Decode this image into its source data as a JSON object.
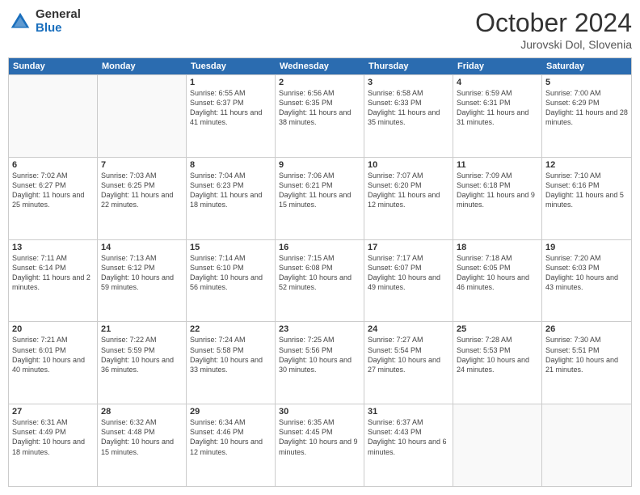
{
  "logo": {
    "general": "General",
    "blue": "Blue"
  },
  "header": {
    "month": "October 2024",
    "location": "Jurovski Dol, Slovenia"
  },
  "weekdays": [
    "Sunday",
    "Monday",
    "Tuesday",
    "Wednesday",
    "Thursday",
    "Friday",
    "Saturday"
  ],
  "weeks": [
    [
      {
        "day": "",
        "sunrise": "",
        "sunset": "",
        "daylight": ""
      },
      {
        "day": "",
        "sunrise": "",
        "sunset": "",
        "daylight": ""
      },
      {
        "day": "1",
        "sunrise": "Sunrise: 6:55 AM",
        "sunset": "Sunset: 6:37 PM",
        "daylight": "Daylight: 11 hours and 41 minutes."
      },
      {
        "day": "2",
        "sunrise": "Sunrise: 6:56 AM",
        "sunset": "Sunset: 6:35 PM",
        "daylight": "Daylight: 11 hours and 38 minutes."
      },
      {
        "day": "3",
        "sunrise": "Sunrise: 6:58 AM",
        "sunset": "Sunset: 6:33 PM",
        "daylight": "Daylight: 11 hours and 35 minutes."
      },
      {
        "day": "4",
        "sunrise": "Sunrise: 6:59 AM",
        "sunset": "Sunset: 6:31 PM",
        "daylight": "Daylight: 11 hours and 31 minutes."
      },
      {
        "day": "5",
        "sunrise": "Sunrise: 7:00 AM",
        "sunset": "Sunset: 6:29 PM",
        "daylight": "Daylight: 11 hours and 28 minutes."
      }
    ],
    [
      {
        "day": "6",
        "sunrise": "Sunrise: 7:02 AM",
        "sunset": "Sunset: 6:27 PM",
        "daylight": "Daylight: 11 hours and 25 minutes."
      },
      {
        "day": "7",
        "sunrise": "Sunrise: 7:03 AM",
        "sunset": "Sunset: 6:25 PM",
        "daylight": "Daylight: 11 hours and 22 minutes."
      },
      {
        "day": "8",
        "sunrise": "Sunrise: 7:04 AM",
        "sunset": "Sunset: 6:23 PM",
        "daylight": "Daylight: 11 hours and 18 minutes."
      },
      {
        "day": "9",
        "sunrise": "Sunrise: 7:06 AM",
        "sunset": "Sunset: 6:21 PM",
        "daylight": "Daylight: 11 hours and 15 minutes."
      },
      {
        "day": "10",
        "sunrise": "Sunrise: 7:07 AM",
        "sunset": "Sunset: 6:20 PM",
        "daylight": "Daylight: 11 hours and 12 minutes."
      },
      {
        "day": "11",
        "sunrise": "Sunrise: 7:09 AM",
        "sunset": "Sunset: 6:18 PM",
        "daylight": "Daylight: 11 hours and 9 minutes."
      },
      {
        "day": "12",
        "sunrise": "Sunrise: 7:10 AM",
        "sunset": "Sunset: 6:16 PM",
        "daylight": "Daylight: 11 hours and 5 minutes."
      }
    ],
    [
      {
        "day": "13",
        "sunrise": "Sunrise: 7:11 AM",
        "sunset": "Sunset: 6:14 PM",
        "daylight": "Daylight: 11 hours and 2 minutes."
      },
      {
        "day": "14",
        "sunrise": "Sunrise: 7:13 AM",
        "sunset": "Sunset: 6:12 PM",
        "daylight": "Daylight: 10 hours and 59 minutes."
      },
      {
        "day": "15",
        "sunrise": "Sunrise: 7:14 AM",
        "sunset": "Sunset: 6:10 PM",
        "daylight": "Daylight: 10 hours and 56 minutes."
      },
      {
        "day": "16",
        "sunrise": "Sunrise: 7:15 AM",
        "sunset": "Sunset: 6:08 PM",
        "daylight": "Daylight: 10 hours and 52 minutes."
      },
      {
        "day": "17",
        "sunrise": "Sunrise: 7:17 AM",
        "sunset": "Sunset: 6:07 PM",
        "daylight": "Daylight: 10 hours and 49 minutes."
      },
      {
        "day": "18",
        "sunrise": "Sunrise: 7:18 AM",
        "sunset": "Sunset: 6:05 PM",
        "daylight": "Daylight: 10 hours and 46 minutes."
      },
      {
        "day": "19",
        "sunrise": "Sunrise: 7:20 AM",
        "sunset": "Sunset: 6:03 PM",
        "daylight": "Daylight: 10 hours and 43 minutes."
      }
    ],
    [
      {
        "day": "20",
        "sunrise": "Sunrise: 7:21 AM",
        "sunset": "Sunset: 6:01 PM",
        "daylight": "Daylight: 10 hours and 40 minutes."
      },
      {
        "day": "21",
        "sunrise": "Sunrise: 7:22 AM",
        "sunset": "Sunset: 5:59 PM",
        "daylight": "Daylight: 10 hours and 36 minutes."
      },
      {
        "day": "22",
        "sunrise": "Sunrise: 7:24 AM",
        "sunset": "Sunset: 5:58 PM",
        "daylight": "Daylight: 10 hours and 33 minutes."
      },
      {
        "day": "23",
        "sunrise": "Sunrise: 7:25 AM",
        "sunset": "Sunset: 5:56 PM",
        "daylight": "Daylight: 10 hours and 30 minutes."
      },
      {
        "day": "24",
        "sunrise": "Sunrise: 7:27 AM",
        "sunset": "Sunset: 5:54 PM",
        "daylight": "Daylight: 10 hours and 27 minutes."
      },
      {
        "day": "25",
        "sunrise": "Sunrise: 7:28 AM",
        "sunset": "Sunset: 5:53 PM",
        "daylight": "Daylight: 10 hours and 24 minutes."
      },
      {
        "day": "26",
        "sunrise": "Sunrise: 7:30 AM",
        "sunset": "Sunset: 5:51 PM",
        "daylight": "Daylight: 10 hours and 21 minutes."
      }
    ],
    [
      {
        "day": "27",
        "sunrise": "Sunrise: 6:31 AM",
        "sunset": "Sunset: 4:49 PM",
        "daylight": "Daylight: 10 hours and 18 minutes."
      },
      {
        "day": "28",
        "sunrise": "Sunrise: 6:32 AM",
        "sunset": "Sunset: 4:48 PM",
        "daylight": "Daylight: 10 hours and 15 minutes."
      },
      {
        "day": "29",
        "sunrise": "Sunrise: 6:34 AM",
        "sunset": "Sunset: 4:46 PM",
        "daylight": "Daylight: 10 hours and 12 minutes."
      },
      {
        "day": "30",
        "sunrise": "Sunrise: 6:35 AM",
        "sunset": "Sunset: 4:45 PM",
        "daylight": "Daylight: 10 hours and 9 minutes."
      },
      {
        "day": "31",
        "sunrise": "Sunrise: 6:37 AM",
        "sunset": "Sunset: 4:43 PM",
        "daylight": "Daylight: 10 hours and 6 minutes."
      },
      {
        "day": "",
        "sunrise": "",
        "sunset": "",
        "daylight": ""
      },
      {
        "day": "",
        "sunrise": "",
        "sunset": "",
        "daylight": ""
      }
    ]
  ]
}
